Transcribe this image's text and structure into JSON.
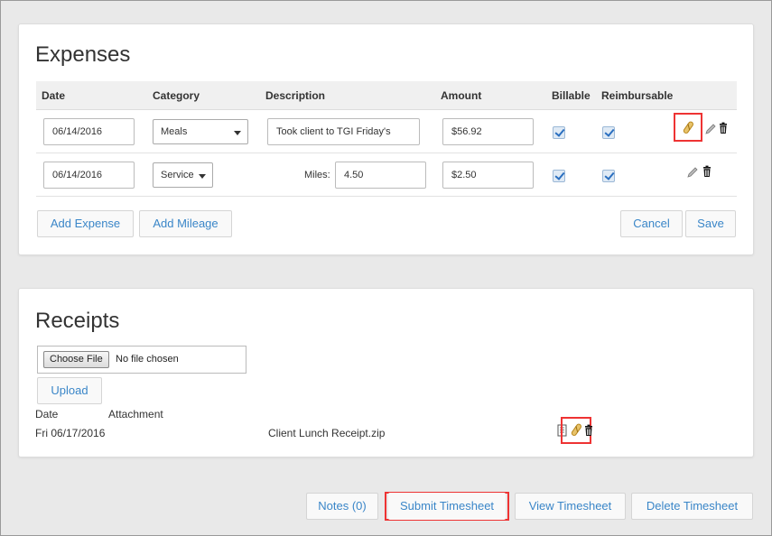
{
  "expenses": {
    "title": "Expenses",
    "columns": [
      "Date",
      "Category",
      "Description",
      "Amount",
      "Billable",
      "Reimbursable"
    ],
    "rows": [
      {
        "date": "06/14/2016",
        "category": "Meals",
        "description": "Took client to TGI Friday's",
        "amount": "$56.92",
        "billable": true,
        "reimbursable": true
      },
      {
        "date": "06/14/2016",
        "category": "Service",
        "miles_label": "Miles:",
        "miles": "4.50",
        "amount": "$2.50",
        "billable": true,
        "reimbursable": true
      }
    ],
    "buttons": {
      "add_expense": "Add Expense",
      "add_mileage": "Add Mileage",
      "cancel": "Cancel",
      "save": "Save"
    }
  },
  "receipts": {
    "title": "Receipts",
    "choose_file": "Choose File",
    "file_status": "No file chosen",
    "upload": "Upload",
    "columns": [
      "Date",
      "Attachment"
    ],
    "rows": [
      {
        "date": "Fri 06/17/2016",
        "attachment": "Client Lunch Receipt.zip"
      }
    ]
  },
  "footer": {
    "notes": "Notes (0)",
    "submit": "Submit Timesheet",
    "view": "View Timesheet",
    "delete": "Delete Timesheet"
  },
  "colors": {
    "link_blue": "#3a86c8",
    "highlight_red": "#e33333",
    "header_bg": "#f0f0f0"
  },
  "icons": [
    "paperclip-icon",
    "edit-icon",
    "trash-icon",
    "document-icon"
  ]
}
